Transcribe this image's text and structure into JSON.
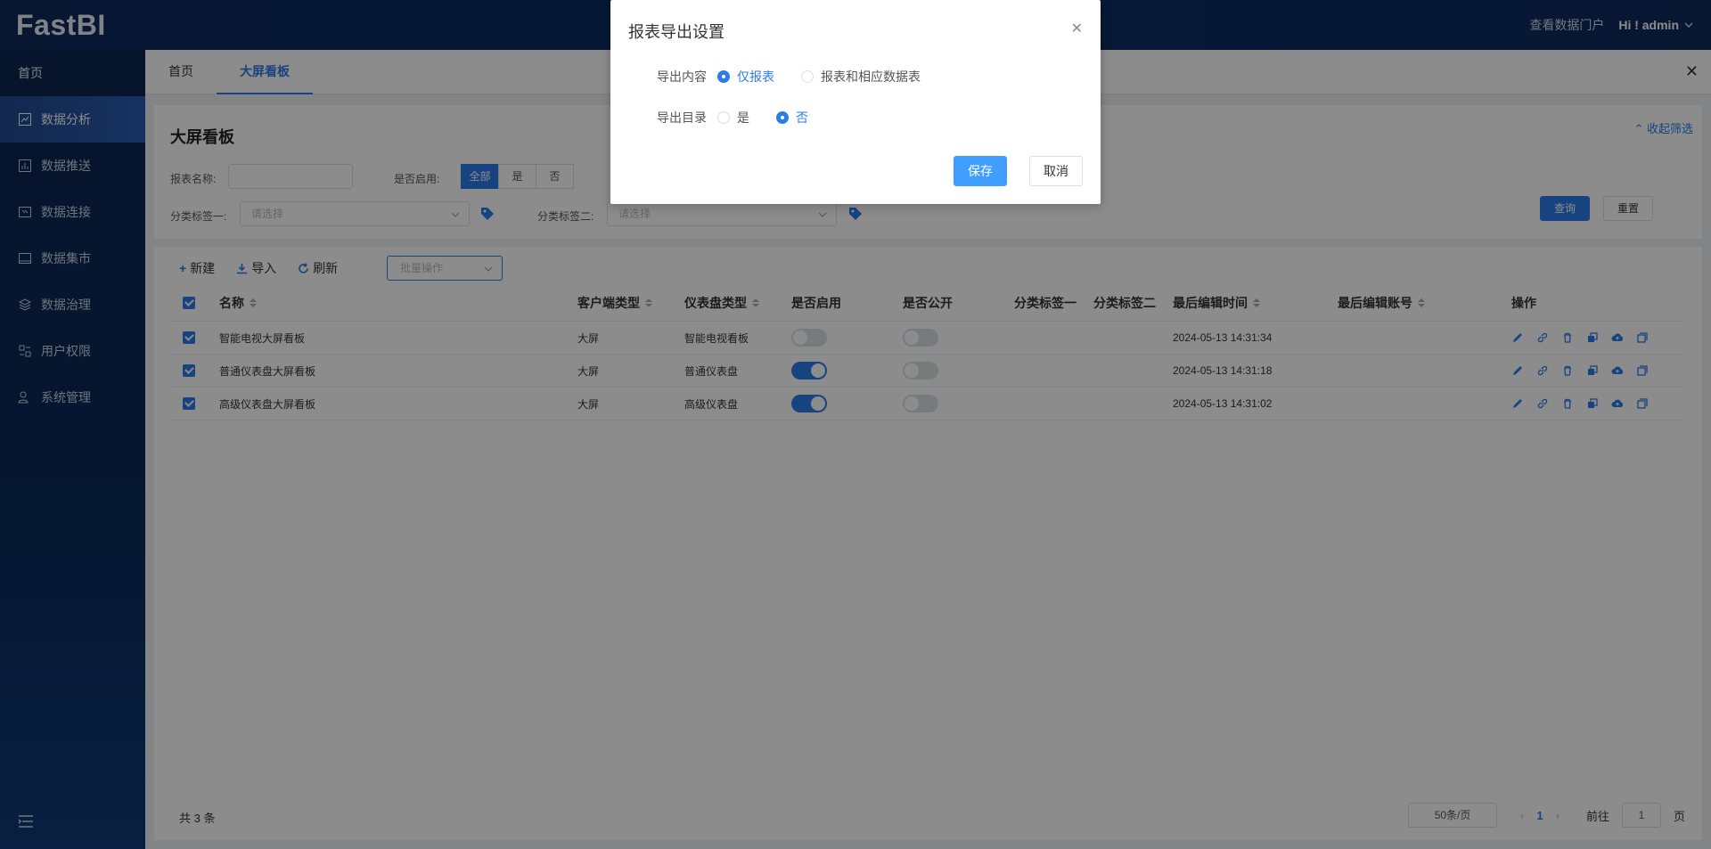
{
  "app": {
    "logo": "FastBI",
    "portal_link": "查看数据门户",
    "user": "Hi ! admin"
  },
  "sidebar": {
    "home": "首页",
    "items": [
      {
        "label": "数据分析",
        "icon": "chart-icon",
        "active": true
      },
      {
        "label": "数据推送",
        "icon": "bar-chart-icon",
        "active": false
      },
      {
        "label": "数据连接",
        "icon": "connect-icon",
        "active": false
      },
      {
        "label": "数据集市",
        "icon": "market-icon",
        "active": false
      },
      {
        "label": "数据治理",
        "icon": "layers-icon",
        "active": false
      },
      {
        "label": "用户权限",
        "icon": "user-permission-icon",
        "active": false
      },
      {
        "label": "系统管理",
        "icon": "system-icon",
        "active": false
      }
    ]
  },
  "tabs": [
    {
      "label": "首页",
      "active": false
    },
    {
      "label": "大屏看板",
      "active": true
    }
  ],
  "filters": {
    "title": "大屏看板",
    "collapse_label": "收起筛选",
    "name_label": "报表名称:",
    "name_value": "",
    "enabled_label": "是否启用:",
    "enabled_options": [
      "全部",
      "是",
      "否"
    ],
    "enabled_selected": "全部",
    "tag1_label": "分类标签一:",
    "tag1_placeholder": "请选择",
    "tag2_label": "分类标签二:",
    "tag2_placeholder": "请选择",
    "query_label": "查询",
    "reset_label": "重置"
  },
  "toolbar": {
    "new_label": "新建",
    "import_label": "导入",
    "refresh_label": "刷新",
    "batch_placeholder": "批量操作"
  },
  "table": {
    "columns": [
      "名称",
      "客户端类型",
      "仪表盘类型",
      "是否启用",
      "是否公开",
      "分类标签一",
      "分类标签二",
      "最后编辑时间",
      "最后编辑账号",
      "操作"
    ],
    "rows": [
      {
        "name": "智能电视大屏看板",
        "client": "大屏",
        "dashboard": "智能电视看板",
        "enabled": false,
        "public": false,
        "tag1": "",
        "tag2": "",
        "edited_at": "2024-05-13 14:31:34",
        "edited_by": ""
      },
      {
        "name": "普通仪表盘大屏看板",
        "client": "大屏",
        "dashboard": "普通仪表盘",
        "enabled": true,
        "public": false,
        "tag1": "",
        "tag2": "",
        "edited_at": "2024-05-13 14:31:18",
        "edited_by": ""
      },
      {
        "name": "高级仪表盘大屏看板",
        "client": "大屏",
        "dashboard": "高级仪表盘",
        "enabled": true,
        "public": false,
        "tag1": "",
        "tag2": "",
        "edited_at": "2024-05-13 14:31:02",
        "edited_by": ""
      }
    ]
  },
  "footer": {
    "total": "共 3 条",
    "page_size": "50条/页",
    "current_page": "1",
    "goto_label": "前往",
    "goto_value": "1",
    "page_suffix": "页"
  },
  "dialog": {
    "title": "报表导出设置",
    "content_label": "导出内容",
    "content_options": [
      "仅报表",
      "报表和相应数据表"
    ],
    "content_selected": "仅报表",
    "dir_label": "导出目录",
    "dir_options": [
      "是",
      "否"
    ],
    "dir_selected": "否",
    "save_label": "保存",
    "cancel_label": "取消"
  },
  "colors": {
    "primary": "#2b7de9",
    "nav": "#0c2650"
  }
}
